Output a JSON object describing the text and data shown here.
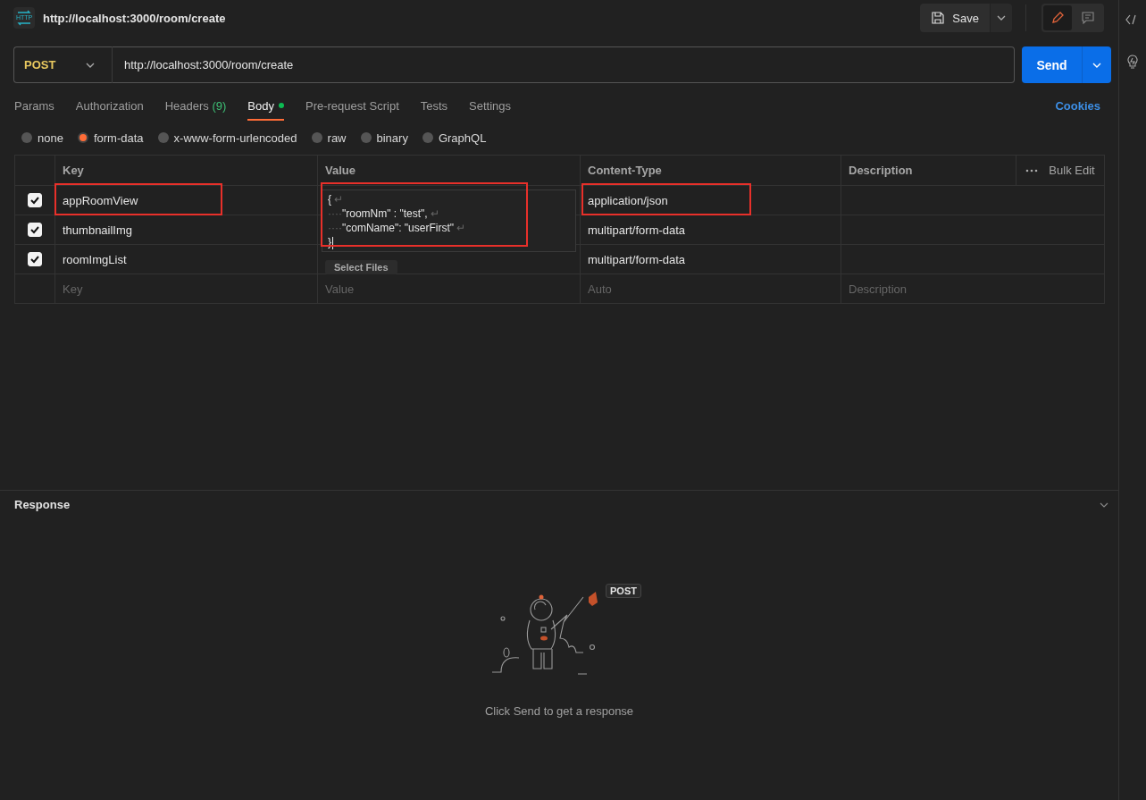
{
  "request_title": "http://localhost:3000/room/create",
  "app_icon_label": "HTTP",
  "save_button": "Save",
  "request": {
    "method": "POST",
    "url": "http://localhost:3000/room/create",
    "send": "Send"
  },
  "tabs": [
    {
      "label": "Params",
      "selected": false,
      "modified": false
    },
    {
      "label": "Authorization",
      "selected": false,
      "modified": false
    },
    {
      "label": "Headers",
      "count": "(9)",
      "selected": false,
      "modified": false
    },
    {
      "label": "Body",
      "selected": true,
      "modified": true
    },
    {
      "label": "Pre-request Script",
      "selected": false,
      "modified": false
    },
    {
      "label": "Tests",
      "selected": false,
      "modified": false
    },
    {
      "label": "Settings",
      "selected": false,
      "modified": false
    }
  ],
  "edit_modes": [
    {
      "kind": "edit",
      "selected": true
    },
    {
      "kind": "comment",
      "selected": false
    }
  ],
  "cookies": "Cookies",
  "body_types": [
    {
      "label": "none",
      "selected": false
    },
    {
      "label": "form-data",
      "selected": true
    },
    {
      "label": "x-www-form-urlencoded",
      "selected": false
    },
    {
      "label": "raw",
      "selected": false
    },
    {
      "label": "binary",
      "selected": false
    },
    {
      "label": "GraphQL",
      "selected": false
    }
  ],
  "table": {
    "columns": [
      "Key",
      "Value",
      "Content-Type",
      "Description"
    ],
    "bulk_edit": "Bulk Edit",
    "rows": [
      {
        "checked": true,
        "key": "appRoomView",
        "kind": "editor",
        "content_type": "application/json",
        "key_highlighted": true,
        "type_highlighted": true
      },
      {
        "checked": true,
        "key": "thumbnailImg",
        "kind": "covered",
        "content_type": "multipart/form-data",
        "key_highlighted": false,
        "type_highlighted": false
      },
      {
        "checked": true,
        "key": "roomImgList",
        "kind": "files",
        "files_button": "Select Files",
        "content_type": "multipart/form-data",
        "key_highlighted": false,
        "type_highlighted": false
      }
    ],
    "placeholder_row": {
      "key": "Key",
      "value": "Value",
      "content_type": "Auto",
      "description": "Description"
    }
  },
  "value_editor": {
    "highlighted": true,
    "lines": [
      {
        "code": "{",
        "eol": "↵"
      },
      {
        "indent": "····",
        "code": "\"roomNm\" : \"test\",",
        "eol": "↵"
      },
      {
        "indent": "····",
        "code": "\"comName\": \"userFirst\"",
        "eol": "↵"
      },
      {
        "code": "}"
      }
    ]
  },
  "response": {
    "title": "Response",
    "badge": "POST",
    "hint": "Click Send to get a response"
  }
}
